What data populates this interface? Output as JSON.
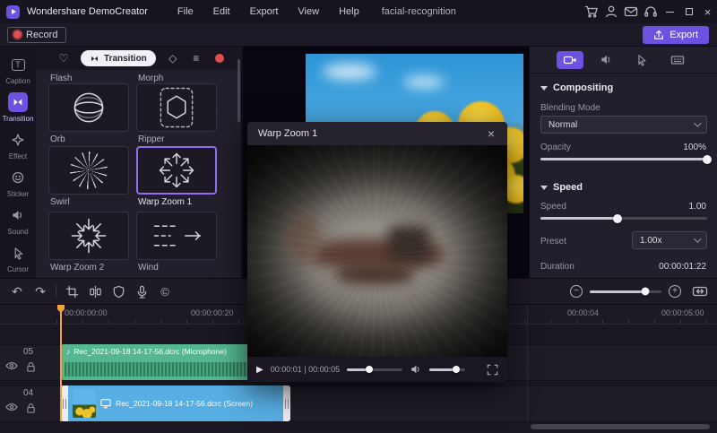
{
  "titlebar": {
    "app_name": "Wondershare DemoCreator",
    "menus": [
      "File",
      "Edit",
      "Export",
      "View",
      "Help"
    ],
    "project_name": "facial-recognition",
    "icons": [
      "cart-icon",
      "user-icon",
      "mail-icon",
      "headset-icon"
    ]
  },
  "record_bar": {
    "record_label": "Record",
    "export_label": "Export"
  },
  "sidebar": {
    "items": [
      {
        "label": "Caption",
        "icon": "caption-icon"
      },
      {
        "label": "Transition",
        "icon": "transition-icon",
        "active": true
      },
      {
        "label": "Effect",
        "icon": "effect-icon"
      },
      {
        "label": "Sticker",
        "icon": "sticker-icon"
      },
      {
        "label": "Sound",
        "icon": "sound-icon"
      },
      {
        "label": "Cursor",
        "icon": "cursor-icon"
      }
    ]
  },
  "transitions_panel": {
    "active_tab_label": "Transition",
    "names": [
      "Flash",
      "Morph",
      "Orb",
      "Ripper",
      "Swirl",
      "Warp Zoom 1",
      "Warp Zoom 2",
      "Wind"
    ],
    "selected": "Warp Zoom 1"
  },
  "preview_modal": {
    "title": "Warp Zoom 1",
    "time_display": "00:00:01 | 00:00:05"
  },
  "properties_panel": {
    "compositing_title": "Compositing",
    "blending_mode_label": "Blending Mode",
    "blending_mode_value": "Normal",
    "opacity_label": "Opacity",
    "opacity_value": "100%",
    "speed_title": "Speed",
    "speed_label": "Speed",
    "speed_value": "1.00",
    "preset_label": "Preset",
    "preset_value": "1.00x",
    "duration_label": "Duration",
    "duration_value": "00:00:01:22"
  },
  "timeline": {
    "ruler_labels": [
      "00:00:00:00",
      "00:00:00:20",
      "00:00:04",
      "00:00:05:00"
    ],
    "tracks": [
      {
        "number": "05",
        "clip_label": "Rec_2021-09-18 14-17-56.dcrc (Microphone)",
        "type": "audio"
      },
      {
        "number": "04",
        "clip_label": "Rec_2021-09-18 14-17-56.dcrc (Screen)",
        "type": "video"
      }
    ]
  },
  "colors": {
    "accent": "#6d51e0",
    "record_red": "#e04f4f",
    "audio_clip": "#55b791",
    "video_clip": "#57aee3",
    "playhead": "#f0a23c"
  }
}
